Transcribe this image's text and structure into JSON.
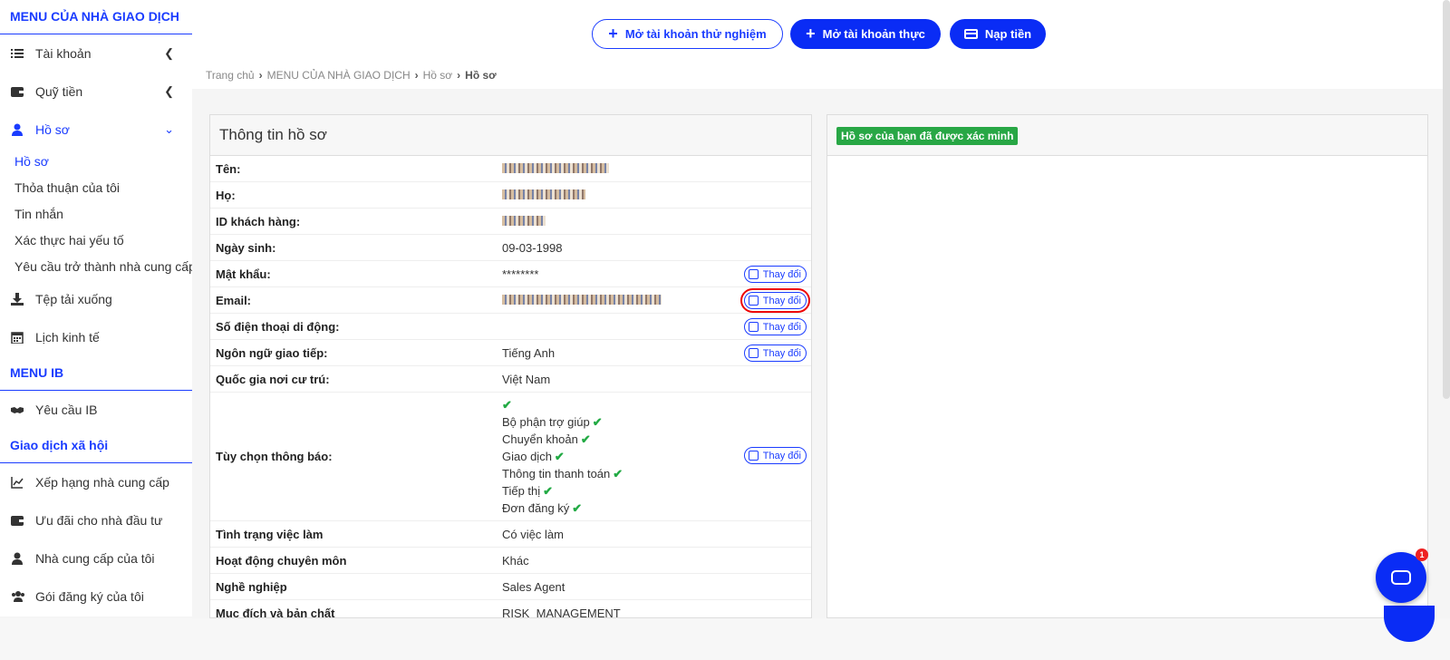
{
  "sidebar": {
    "section_trader": "MENU CỦA NHÀ GIAO DỊCH",
    "items": [
      {
        "label": "Tài khoản"
      },
      {
        "label": "Quỹ tiền"
      },
      {
        "label": "Hồ sơ"
      }
    ],
    "profile_sub": [
      "Hồ sơ",
      "Thỏa thuận của tôi",
      "Tin nhắn",
      "Xác thực hai yếu tố",
      "Yêu cầu trở thành nhà cung cấp"
    ],
    "items2": [
      {
        "label": "Tệp tải xuống"
      },
      {
        "label": "Lịch kinh tế"
      }
    ],
    "section_ib": "MENU IB",
    "ib_items": [
      {
        "label": "Yêu cầu IB"
      }
    ],
    "section_social": "Giao dịch xã hội",
    "social_items": [
      {
        "label": "Xếp hạng nhà cung cấp"
      },
      {
        "label": "Ưu đãi cho nhà đầu tư"
      },
      {
        "label": "Nhà cung cấp của tôi"
      },
      {
        "label": "Gói đăng ký của tôi"
      }
    ]
  },
  "header": {
    "demo_btn": "Mở tài khoản thử nghiệm",
    "real_btn": "Mở tài khoản thực",
    "deposit_btn": "Nạp tiền"
  },
  "breadcrumb": [
    "Trang chủ",
    "MENU CỦA NHÀ GIAO DỊCH",
    "Hồ sơ",
    "Hồ sơ"
  ],
  "profile": {
    "title": "Thông tin hồ sơ",
    "change_label": "Thay đổi",
    "rows": [
      {
        "label": "Tên:",
        "value": ""
      },
      {
        "label": "Họ:",
        "value": ""
      },
      {
        "label": "ID khách hàng:",
        "value": ""
      },
      {
        "label": "Ngày sinh:",
        "value": "09-03-1998"
      },
      {
        "label": "Mật khẩu:",
        "value": "********"
      },
      {
        "label": "Email:",
        "value": ""
      },
      {
        "label": "Số điện thoại di động:",
        "value": ""
      },
      {
        "label": "Ngôn ngữ giao tiếp:",
        "value": "Tiếng Anh"
      },
      {
        "label": "Quốc gia nơi cư trú:",
        "value": "Việt Nam"
      }
    ],
    "notif_label": "Tùy chọn thông báo:",
    "notif_items": [
      "Bộ phận trợ giúp",
      "Chuyển khoản",
      "Giao dịch",
      "Thông tin thanh toán",
      "Tiếp thị",
      "Đơn đăng ký"
    ],
    "rows2": [
      {
        "label": "Tình trạng việc làm",
        "value": "Có việc làm"
      },
      {
        "label": "Hoạt động chuyên môn",
        "value": "Khác"
      },
      {
        "label": "Nghề nghiệp",
        "value": "Sales Agent"
      },
      {
        "label": "Mục đích và bản chất",
        "value": "RISK_MANAGEMENT"
      }
    ]
  },
  "verify": {
    "badge": "Hồ sơ của bạn đã được xác minh"
  },
  "chat": {
    "badge_count": "1"
  },
  "colors": {
    "accent": "#0a2cf5",
    "verified": "#28a745",
    "highlight": "#e00000"
  }
}
